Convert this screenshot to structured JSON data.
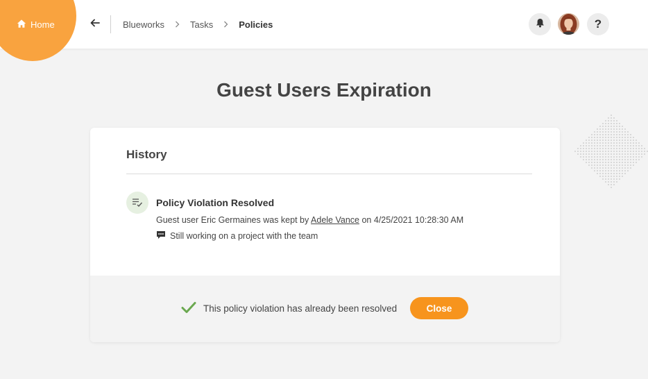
{
  "nav": {
    "home_label": "Home",
    "breadcrumb": [
      "Blueworks",
      "Tasks",
      "Policies"
    ]
  },
  "icons": {
    "home": "home-icon",
    "back": "arrow-left-icon",
    "bell": "bell-icon",
    "help": "help-icon",
    "history_item": "checklist-icon",
    "comment": "comment-icon",
    "check": "check-icon"
  },
  "header": {
    "help_label": "?"
  },
  "page": {
    "title": "Guest Users Expiration"
  },
  "history": {
    "heading": "History",
    "item": {
      "title": "Policy Violation Resolved",
      "text_before": "Guest user Eric Germaines was kept by",
      "user_link": "Adele Vance",
      "text_after": "on 4/25/2021 10:28:30 AM",
      "comment": "Still working on a project with the team"
    }
  },
  "footer": {
    "status_text": "This policy violation has already been resolved",
    "close_label": "Close"
  },
  "colors": {
    "accent": "#f7941d",
    "home_circle": "#f9a33f",
    "success": "#6aa84f"
  }
}
